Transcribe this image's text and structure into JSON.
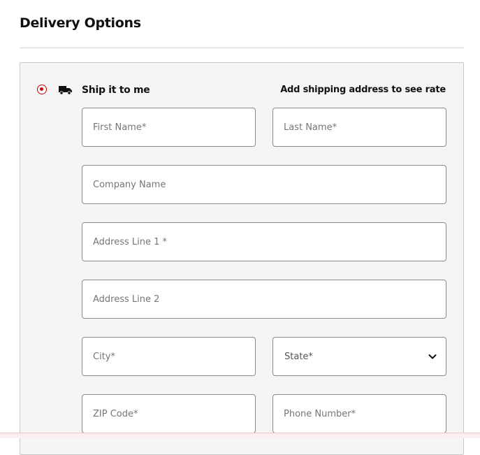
{
  "page": {
    "title": "Delivery Options"
  },
  "delivery": {
    "option_label": "Ship it to me",
    "selected": true,
    "rate_note": "Add shipping address to see rate",
    "truck_icon": "truck-icon"
  },
  "form": {
    "first_name": {
      "placeholder": "First Name*",
      "value": ""
    },
    "last_name": {
      "placeholder": "Last Name*",
      "value": ""
    },
    "company": {
      "placeholder": "Company Name",
      "value": ""
    },
    "address1": {
      "placeholder": "Address Line 1 *",
      "value": ""
    },
    "address2": {
      "placeholder": "Address Line 2",
      "value": ""
    },
    "city": {
      "placeholder": "City*",
      "value": ""
    },
    "state": {
      "selected": "State*"
    },
    "zip": {
      "placeholder": "ZIP Code*",
      "value": ""
    },
    "phone": {
      "placeholder": "Phone Number*",
      "value": ""
    }
  },
  "colors": {
    "accent": "#cc0000",
    "panel_background": "#f5f5f5",
    "field_border": "#8a8a8a"
  }
}
